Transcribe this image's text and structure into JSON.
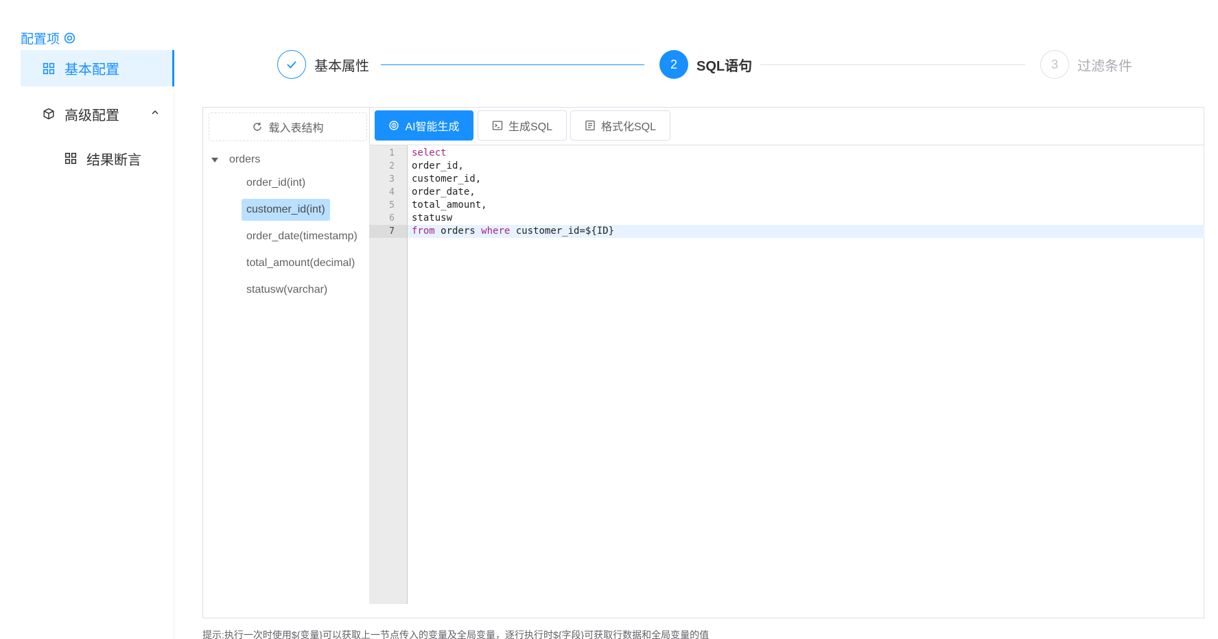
{
  "sidebar": {
    "header": "配置项",
    "items": [
      {
        "label": "基本配置",
        "active": true
      },
      {
        "label": "高级配置",
        "expanded": true
      },
      {
        "label": "结果断言"
      }
    ]
  },
  "steps": [
    {
      "label": "基本属性",
      "status": "done"
    },
    {
      "number": "2",
      "label": "SQL语句",
      "status": "current"
    },
    {
      "number": "3",
      "label": "过滤条件",
      "status": "pending"
    }
  ],
  "tree": {
    "load_label": "载入表结构",
    "table": "orders",
    "fields": [
      "order_id(int)",
      "customer_id(int)",
      "order_date(timestamp)",
      "total_amount(decimal)",
      "statusw(varchar)"
    ],
    "selected_index": 1
  },
  "toolbar": {
    "ai_label": "AI智能生成",
    "gen_label": "生成SQL",
    "format_label": "格式化SQL"
  },
  "editor": {
    "current_line": 7,
    "lines": [
      {
        "no": "1",
        "parts": [
          {
            "t": "select",
            "k": "kw"
          }
        ]
      },
      {
        "no": "2",
        "parts": [
          {
            "t": "order_id,"
          }
        ]
      },
      {
        "no": "3",
        "parts": [
          {
            "t": "customer_id,"
          }
        ]
      },
      {
        "no": "4",
        "parts": [
          {
            "t": "order_date,"
          }
        ]
      },
      {
        "no": "5",
        "parts": [
          {
            "t": "total_amount,"
          }
        ]
      },
      {
        "no": "6",
        "parts": [
          {
            "t": "statusw"
          }
        ]
      },
      {
        "no": "7",
        "parts": [
          {
            "t": "from",
            "k": "kw"
          },
          {
            "t": " orders "
          },
          {
            "t": "where",
            "k": "kw"
          },
          {
            "t": " customer_id=${ID}"
          }
        ]
      }
    ]
  },
  "hint": "提示:执行一次时使用${变量}可以获取上一节点传入的变量及全局变量，逐行执行时${字段}可获取行数据和全局变量的值",
  "colors": {
    "accent": "#1890ff",
    "keyword": "#a0288c"
  }
}
